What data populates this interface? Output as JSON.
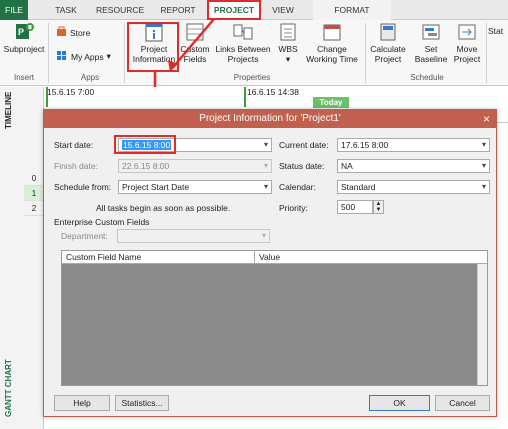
{
  "ribbon": {
    "tabs": [
      "FILE",
      "TASK",
      "RESOURCE",
      "REPORT",
      "PROJECT",
      "VIEW",
      "FORMAT"
    ],
    "buttons": {
      "subproject": "Subproject",
      "store": "Store",
      "my_apps": "My Apps",
      "project_information_line1": "Project",
      "project_information_line2": "Information",
      "custom_fields_line1": "Custom",
      "custom_fields_line2": "Fields",
      "links_between_line1": "Links Between",
      "links_between_line2": "Projects",
      "wbs": "WBS",
      "change_working_time_line1": "Change",
      "change_working_time_line2": "Working Time",
      "calculate_line1": "Calculate",
      "calculate_line2": "Project",
      "set_baseline_line1": "Set",
      "set_baseline_line2": "Baseline",
      "move_project_line1": "Move",
      "move_project_line2": "Project",
      "status_cut": "Stat"
    },
    "groups": {
      "insert": "Insert",
      "apps": "Apps",
      "properties": "Properties",
      "schedule": "Schedule"
    }
  },
  "sidebar": {
    "timeline_label": "TIMELINE",
    "gantt_label": "GANTT CHART",
    "row_numbers": [
      "0",
      "1",
      "2"
    ]
  },
  "timeline": {
    "start_date": "15.6.15 7:00",
    "current_date": "16.6.15 14:38",
    "today_label": "Today"
  },
  "dialog": {
    "title": "Project Information for 'Project1'",
    "close_glyph": "×",
    "start_date_label": "Start date:",
    "start_date_value": "15.6.15 8:00",
    "finish_date_label": "Finish date:",
    "finish_date_value": "22.6.15 8:00",
    "schedule_from_label": "Schedule from:",
    "schedule_from_value": "Project Start Date",
    "schedule_note": "All tasks begin as soon as possible.",
    "current_date_label": "Current date:",
    "current_date_value": "17.6.15 8:00",
    "status_date_label": "Status date:",
    "status_date_value": "NA",
    "calendar_label": "Calendar:",
    "calendar_value": "Standard",
    "priority_label": "Priority:",
    "priority_value": "500",
    "enterprise_label": "Enterprise Custom Fields",
    "department_label": "Department:",
    "department_value": "",
    "grid_headers": [
      "Custom Field Name",
      "Value"
    ],
    "help_button": "Help",
    "statistics_button": "Statistics...",
    "ok_button": "OK",
    "cancel_button": "Cancel"
  },
  "colors": {
    "file_tab": "#217346",
    "dialog_title_bar": "#c1604f",
    "highlight_red": "#e02b2b",
    "selection_blue": "#3399ff"
  }
}
